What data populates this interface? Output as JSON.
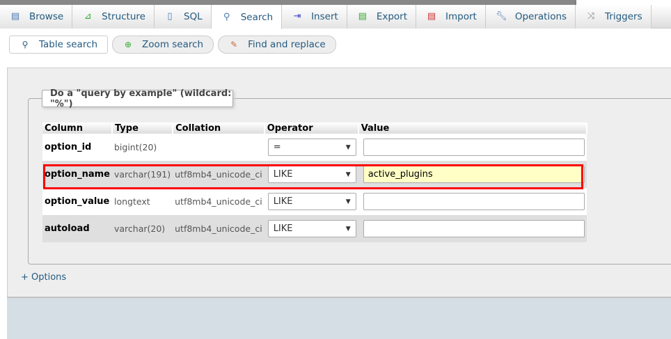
{
  "tabs": [
    {
      "label": "Browse",
      "icon": "table-icon"
    },
    {
      "label": "Structure",
      "icon": "structure-icon"
    },
    {
      "label": "SQL",
      "icon": "sql-icon"
    },
    {
      "label": "Search",
      "icon": "search-icon",
      "active": true
    },
    {
      "label": "Insert",
      "icon": "insert-icon"
    },
    {
      "label": "Export",
      "icon": "export-icon"
    },
    {
      "label": "Import",
      "icon": "import-icon"
    },
    {
      "label": "Operations",
      "icon": "wrench-icon"
    },
    {
      "label": "Triggers",
      "icon": "triggers-icon"
    }
  ],
  "subtabs": [
    {
      "label": "Table search"
    },
    {
      "label": "Zoom search"
    },
    {
      "label": "Find and replace"
    }
  ],
  "legend": "Do a \"query by example\" (wildcard: \"%\")",
  "table": {
    "headers": [
      "Column",
      "Type",
      "Collation",
      "Operator",
      "Value"
    ],
    "rows": [
      {
        "column": "option_id",
        "type": "bigint(20)",
        "collation": "",
        "operator": "=",
        "value": ""
      },
      {
        "column": "option_name",
        "type": "varchar(191)",
        "collation": "utf8mb4_unicode_ci",
        "operator": "LIKE",
        "value": "active_plugins"
      },
      {
        "column": "option_value",
        "type": "longtext",
        "collation": "utf8mb4_unicode_ci",
        "operator": "LIKE",
        "value": ""
      },
      {
        "column": "autoload",
        "type": "varchar(20)",
        "collation": "utf8mb4_unicode_ci",
        "operator": "LIKE",
        "value": ""
      }
    ]
  },
  "options_link": "+ Options",
  "colors": {
    "highlight": "#ff0000",
    "link": "#235a81"
  }
}
